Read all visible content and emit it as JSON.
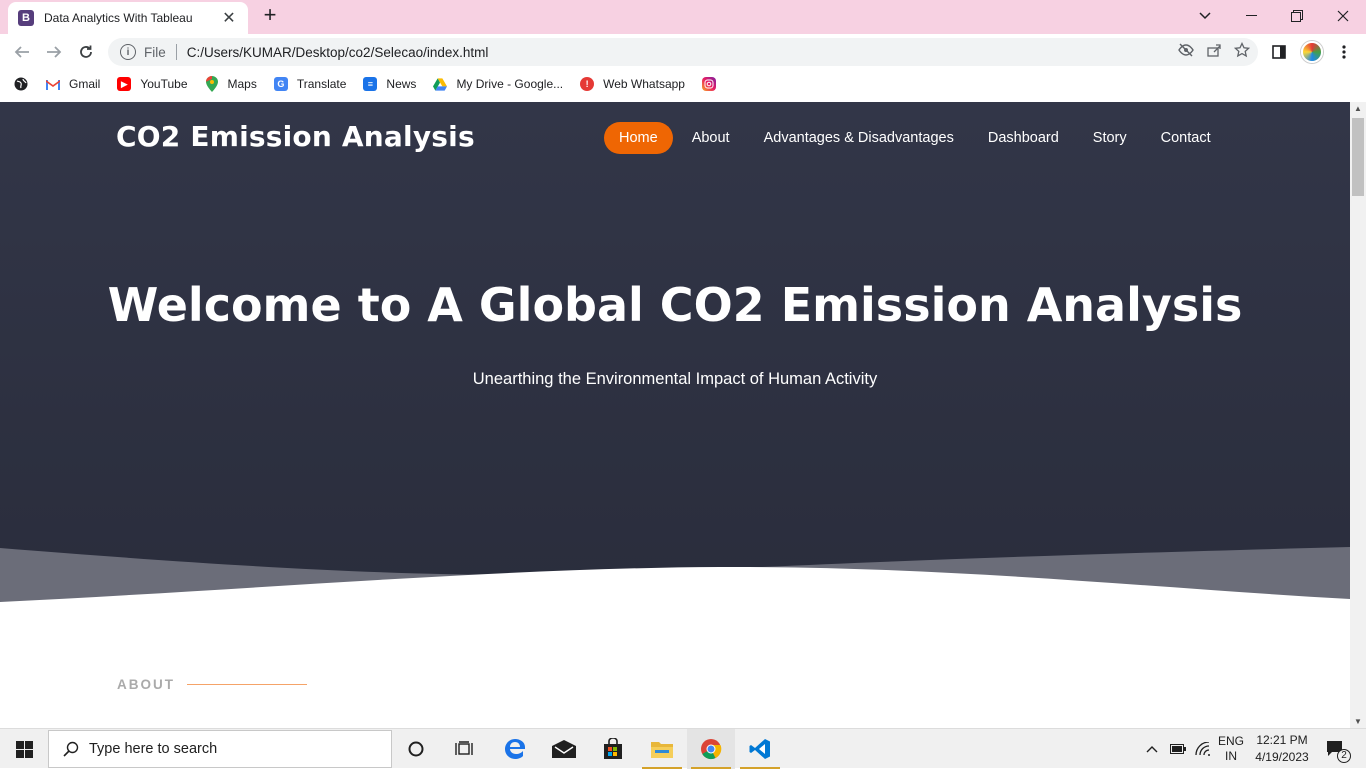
{
  "browser": {
    "tab_title": "Data Analytics With Tableau",
    "tab_favicon_letter": "B",
    "new_tab_symbol": "+",
    "address_scheme": "File",
    "address_url": "C:/Users/KUMAR/Desktop/co2/Selecao/index.html"
  },
  "bookmarks": [
    {
      "label": "Gmail",
      "icon": "gmail-icon",
      "color": "#ea4335"
    },
    {
      "label": "YouTube",
      "icon": "youtube-icon",
      "color": "#ff0000"
    },
    {
      "label": "Maps",
      "icon": "maps-icon",
      "color": "#34a853"
    },
    {
      "label": "Translate",
      "icon": "translate-icon",
      "color": "#4285f4"
    },
    {
      "label": "News",
      "icon": "news-icon",
      "color": "#1a73e8"
    },
    {
      "label": "My Drive - Google...",
      "icon": "drive-icon",
      "color": "#fbbc04"
    },
    {
      "label": "Web Whatsapp",
      "icon": "whatsapp-icon",
      "color": "#e53935"
    },
    {
      "label": "",
      "icon": "instagram-icon",
      "color": "#c13584"
    }
  ],
  "site": {
    "logo": "CO2 Emission Analysis",
    "nav": {
      "home": "Home",
      "about": "About",
      "advantages": "Advantages & Disadvantages",
      "dashboard": "Dashboard",
      "story": "Story",
      "contact": "Contact"
    },
    "hero_title": "Welcome to A Global CO2 Emission Analysis",
    "hero_subtitle": "Unearthing the Environmental Impact of Human Activity",
    "section_label": "ABOUT",
    "accent_color": "#ef6603",
    "hero_color": "#2e3142"
  },
  "taskbar": {
    "search_placeholder": "Type here to search",
    "language_line1": "ENG",
    "language_line2": "IN",
    "time": "12:21 PM",
    "date": "4/19/2023",
    "notification_count": "2"
  }
}
